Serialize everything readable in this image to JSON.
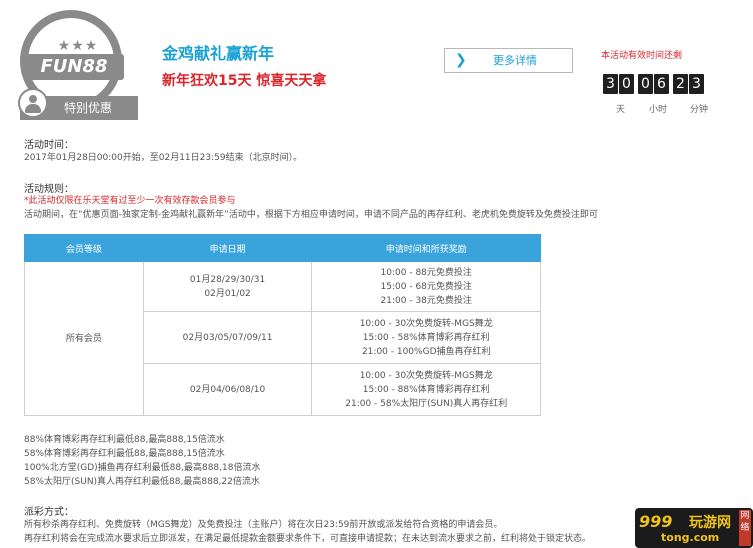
{
  "badge": {
    "brand": "FUN88",
    "ribbon": "特别优惠"
  },
  "promo": {
    "title": "金鸡献礼赢新年",
    "subtitle": "新年狂欢15天 惊喜天天拿",
    "more_label": "更多详情"
  },
  "countdown": {
    "label": "本活动有效时间还剩",
    "digits": [
      "3",
      "0",
      "0",
      "6",
      "2",
      "3"
    ],
    "units": [
      "天",
      "小时",
      "分钟"
    ]
  },
  "time_section": {
    "title": "活动时间：",
    "text": "2017年01月28日00:00开始，至02月11日23:59结束（北京时间）。"
  },
  "rules_section": {
    "title": "活动规则：",
    "note": "*此活动仅限在乐天堂有过至少一次有效存款会员参与",
    "text": "活动期间，在“优惠页面-独家定制-金鸡献礼赢新年”活动中，根据下方相应申请时间，申请不同产品的再存红利、老虎机免费旋转及免费投注即可"
  },
  "table": {
    "headers": [
      "会员等级",
      "申请日期",
      "申请时间和所获奖励"
    ],
    "member_level": "所有会员",
    "rows": [
      {
        "dates": [
          "01月28/29/30/31",
          "02月01/02"
        ],
        "rewards": [
          "10:00 - 88元免费投注",
          "15:00 - 68元免费投注",
          "21:00 - 38元免费投注"
        ]
      },
      {
        "dates": [
          "02月03/05/07/09/11"
        ],
        "rewards": [
          "10:00 - 30次免费旋转-MGS舞龙",
          "15:00 - 58%体育博彩再存红利",
          "21:00 - 100%GD捕鱼再存红利"
        ]
      },
      {
        "dates": [
          "02月04/06/08/10"
        ],
        "rewards": [
          "10:00 - 30次免费旋转-MGS舞龙",
          "15:00 - 88%体育博彩再存红利",
          "21:00 - 58%太阳厅(SUN)真人再存红利"
        ]
      }
    ]
  },
  "bonus_notes": [
    "88%体育博彩再存红利最低88,最高888,15倍流水",
    "58%体育博彩再存红利最低88,最高888,15倍流水",
    "100%北方堂(GD)捕鱼再存红利最低88,最高888,18倍流水",
    "58%太阳厅(SUN)真人再存红利最低88,最高888,22倍流水"
  ],
  "payout_section": {
    "title": "派彩方式：",
    "lines": [
      "所有秒杀再存红利、免费旋转（MGS舞龙）及免费投注（主账户）将在次日23:59前开放或派发给符合资格的申请会员。",
      "再存红利将会在完成流水要求后立即派发，在满足最低提款金额要求条件下，可直接申请提款；在未达到流水要求之前，红利将处于锁定状态。"
    ]
  },
  "watermark": {
    "num": "999",
    "cn": "玩游网",
    "domain": "tong.com",
    "side": "网络"
  },
  "colors": {
    "accent": "#1aa2d4",
    "red": "#d9262c",
    "header": "#3aa3db",
    "gray": "#8a8a8a"
  }
}
